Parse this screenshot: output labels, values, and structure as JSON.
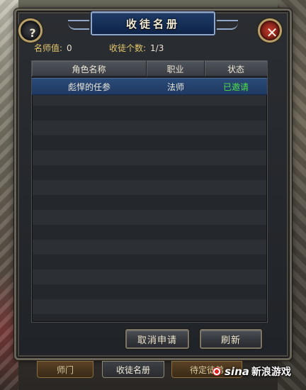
{
  "window": {
    "title": "收徒名册",
    "help_glyph": "?",
    "close_glyph": "✕"
  },
  "stats": {
    "mentor_label": "名师值:",
    "mentor_value": "0",
    "count_label": "收徒个数:",
    "count_value": "1/3"
  },
  "table": {
    "columns": [
      "角色名称",
      "职业",
      "状态"
    ],
    "rows": [
      {
        "name": "彪悍的任参",
        "job": "法师",
        "status": "已邀请"
      }
    ]
  },
  "buttons": {
    "cancel_label": "取消申请",
    "refresh_label": "刷新"
  },
  "tabs": [
    {
      "label": "师门"
    },
    {
      "label": "收徒名册"
    },
    {
      "label": "待定徒弟"
    }
  ],
  "watermark": {
    "brand": "sina",
    "text": "新浪游戏"
  },
  "colors": {
    "status_invited": "#4fe04a",
    "label_gold": "#e6c76e",
    "title_blue": "#163058"
  }
}
